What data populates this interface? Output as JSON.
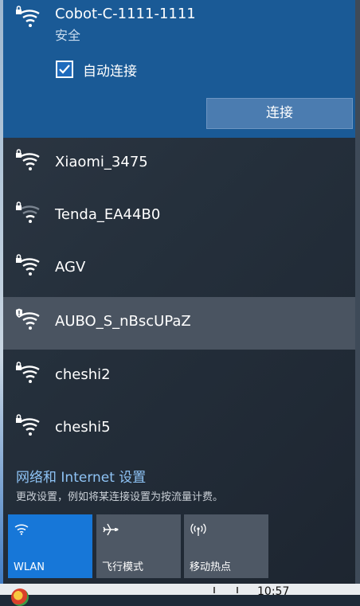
{
  "selected_network": {
    "name": "Cobot-C-1111-1111",
    "status": "安全",
    "auto_connect_label": "自动连接",
    "auto_connect_checked": true,
    "connect_button": "连接",
    "icon": "wifi-secured-icon"
  },
  "networks": [
    {
      "name": "Xiaomi_3475",
      "icon": "wifi-secured-icon"
    },
    {
      "name": "Tenda_EA44B0",
      "icon": "wifi-secured-weak-icon"
    },
    {
      "name": "AGV",
      "icon": "wifi-secured-icon"
    },
    {
      "name": "AUBO_S_nBscUPaZ",
      "icon": "wifi-warning-icon"
    },
    {
      "name": "cheshi2",
      "icon": "wifi-secured-icon"
    },
    {
      "name": "cheshi5",
      "icon": "wifi-secured-icon"
    }
  ],
  "settings": {
    "link": "网络和 Internet 设置",
    "description": "更改设置，例如将某连接设置为按流量计费。"
  },
  "quick_actions": [
    {
      "label": "WLAN",
      "icon": "wifi-icon",
      "active": true
    },
    {
      "label": "飞行模式",
      "icon": "airplane-icon",
      "active": false
    },
    {
      "label": "移动热点",
      "icon": "hotspot-icon",
      "active": false
    }
  ],
  "taskbar": {
    "time": "10:57"
  },
  "colors": {
    "selected_bg": "#1a5a96",
    "tile_active": "#1777d8",
    "tile_inactive": "#4e5865",
    "link": "#8ec3f5"
  }
}
